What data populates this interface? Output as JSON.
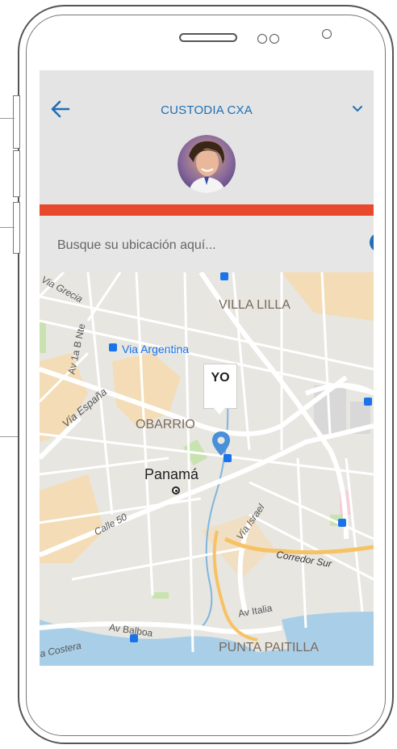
{
  "header": {
    "back_icon": "arrow-left-icon",
    "title": "CUSTODIA CXA",
    "dropdown_icon": "chevron-down-icon",
    "accent_color": "#1f6fb5",
    "bar_color": "#e8482b"
  },
  "search": {
    "placeholder": "Busque su ubicación aquí..."
  },
  "map": {
    "marker_label": "YO",
    "labels": {
      "via_grecia": "Via Grecia",
      "villa_lilla": "VILLA LILLA",
      "av_1a_b_nte": "Av 1a B Nte",
      "via_argentina": "Via Argentina",
      "via_espana": "Vía España",
      "obarrio": "OBARRIO",
      "panama": "Panamá",
      "calle_50": "Calle 50",
      "via_israel": "Vía Israel",
      "corredor_sur": "Corredor Sur",
      "av_italia": "Av Italia",
      "av_balboa": "Av Balboa",
      "costera": "a Costera",
      "punta_paitilla": "PUNTA PAITILLA"
    }
  }
}
